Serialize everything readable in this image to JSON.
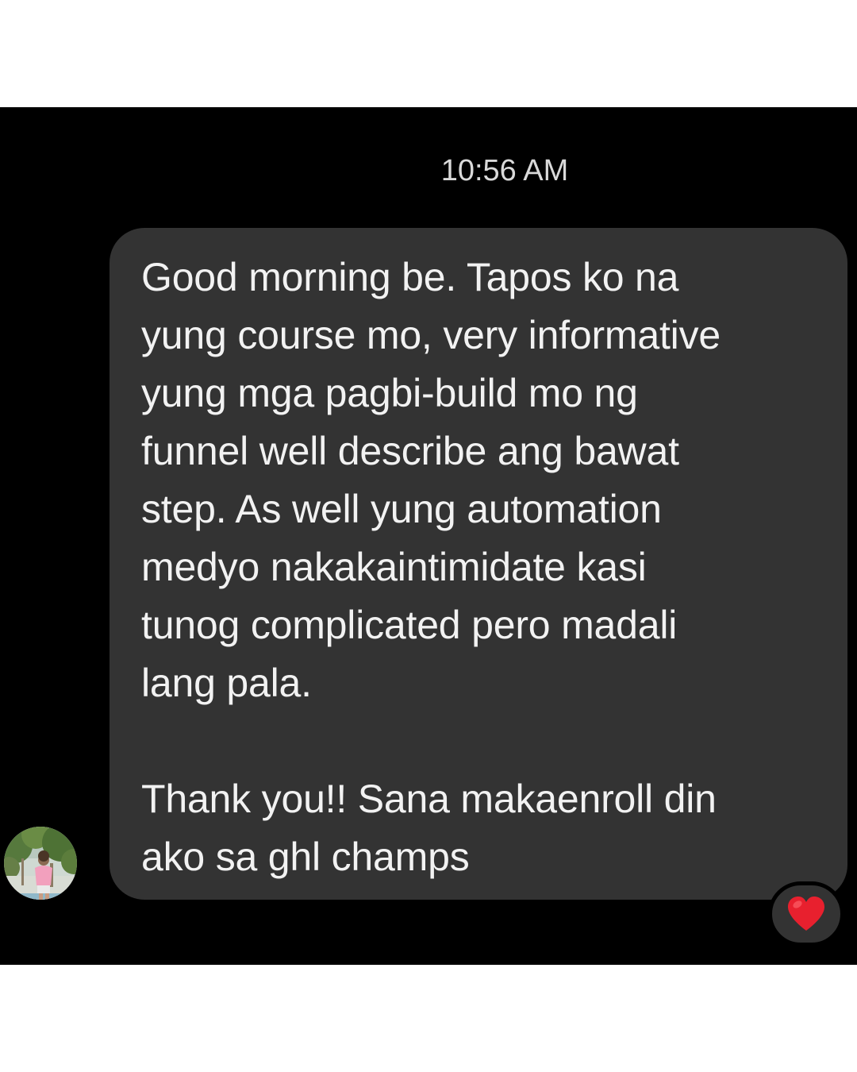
{
  "chat": {
    "timestamp": "10:56 AM",
    "message": {
      "lines": [
        "Good morning be. Tapos ko na",
        "yung course mo, very informative",
        "yung mga pagbi-build mo ng",
        "funnel well describe ang bawat",
        "step. As well yung automation",
        "medyo nakakaintimidate kasi",
        "tunog complicated pero madali",
        "lang pala.",
        "",
        "Thank you!! Sana makaenroll din",
        "ako sa ghl champs"
      ],
      "reaction": "heart-icon"
    },
    "sender_avatar": "profile-photo"
  },
  "colors": {
    "panel_background": "#000000",
    "bubble_background": "#333333",
    "message_text": "#f2f2f2",
    "timestamp_text": "#d9d9d9",
    "reaction_heart": "#e8202e"
  }
}
